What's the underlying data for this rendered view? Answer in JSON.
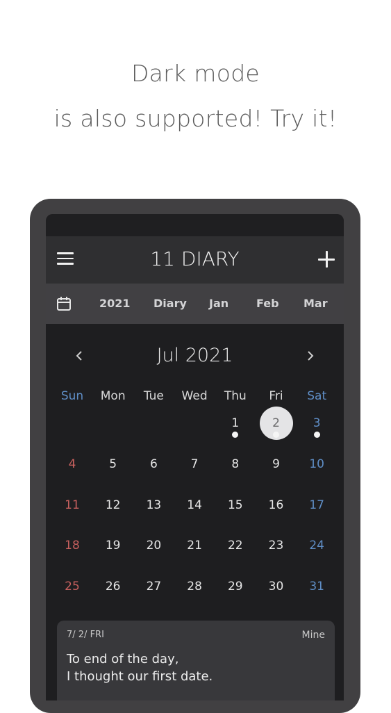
{
  "promo": {
    "line1": "Dark mode",
    "line2": "is also supported! Try it!"
  },
  "appbar": {
    "title": "11 DIARY",
    "menu_icon": "hamburger-menu-icon",
    "add_icon": "plus-icon"
  },
  "tabs": {
    "calendar_icon": "calendar-icon",
    "items": [
      "2021",
      "Diary",
      "Jan",
      "Feb",
      "Mar"
    ]
  },
  "calendar": {
    "month_title": "Jul 2021",
    "prev_icon": "chevron-left-icon",
    "next_icon": "chevron-right-icon",
    "weekdays": [
      "Sun",
      "Mon",
      "Tue",
      "Wed",
      "Thu",
      "Fri",
      "Sat"
    ],
    "weeks": [
      [
        "",
        "",
        "",
        "",
        "1",
        "2",
        "3"
      ],
      [
        "4",
        "5",
        "6",
        "7",
        "8",
        "9",
        "10"
      ],
      [
        "11",
        "12",
        "13",
        "14",
        "15",
        "16",
        "17"
      ],
      [
        "18",
        "19",
        "20",
        "21",
        "22",
        "23",
        "24"
      ],
      [
        "25",
        "26",
        "27",
        "28",
        "29",
        "30",
        "31"
      ]
    ],
    "selected_day": "2",
    "entry_days": [
      "1",
      "2",
      "3"
    ]
  },
  "entry": {
    "date": "7/ 2/ FRI",
    "tag": "Mine",
    "line1": "To end of the day,",
    "line2": "I thought our first date."
  },
  "colors": {
    "sunday": "#c7605e",
    "saturday": "#5f8ec6",
    "background": "#1e1e20",
    "appbar": "#2f2f31",
    "tabbar": "#414043"
  }
}
